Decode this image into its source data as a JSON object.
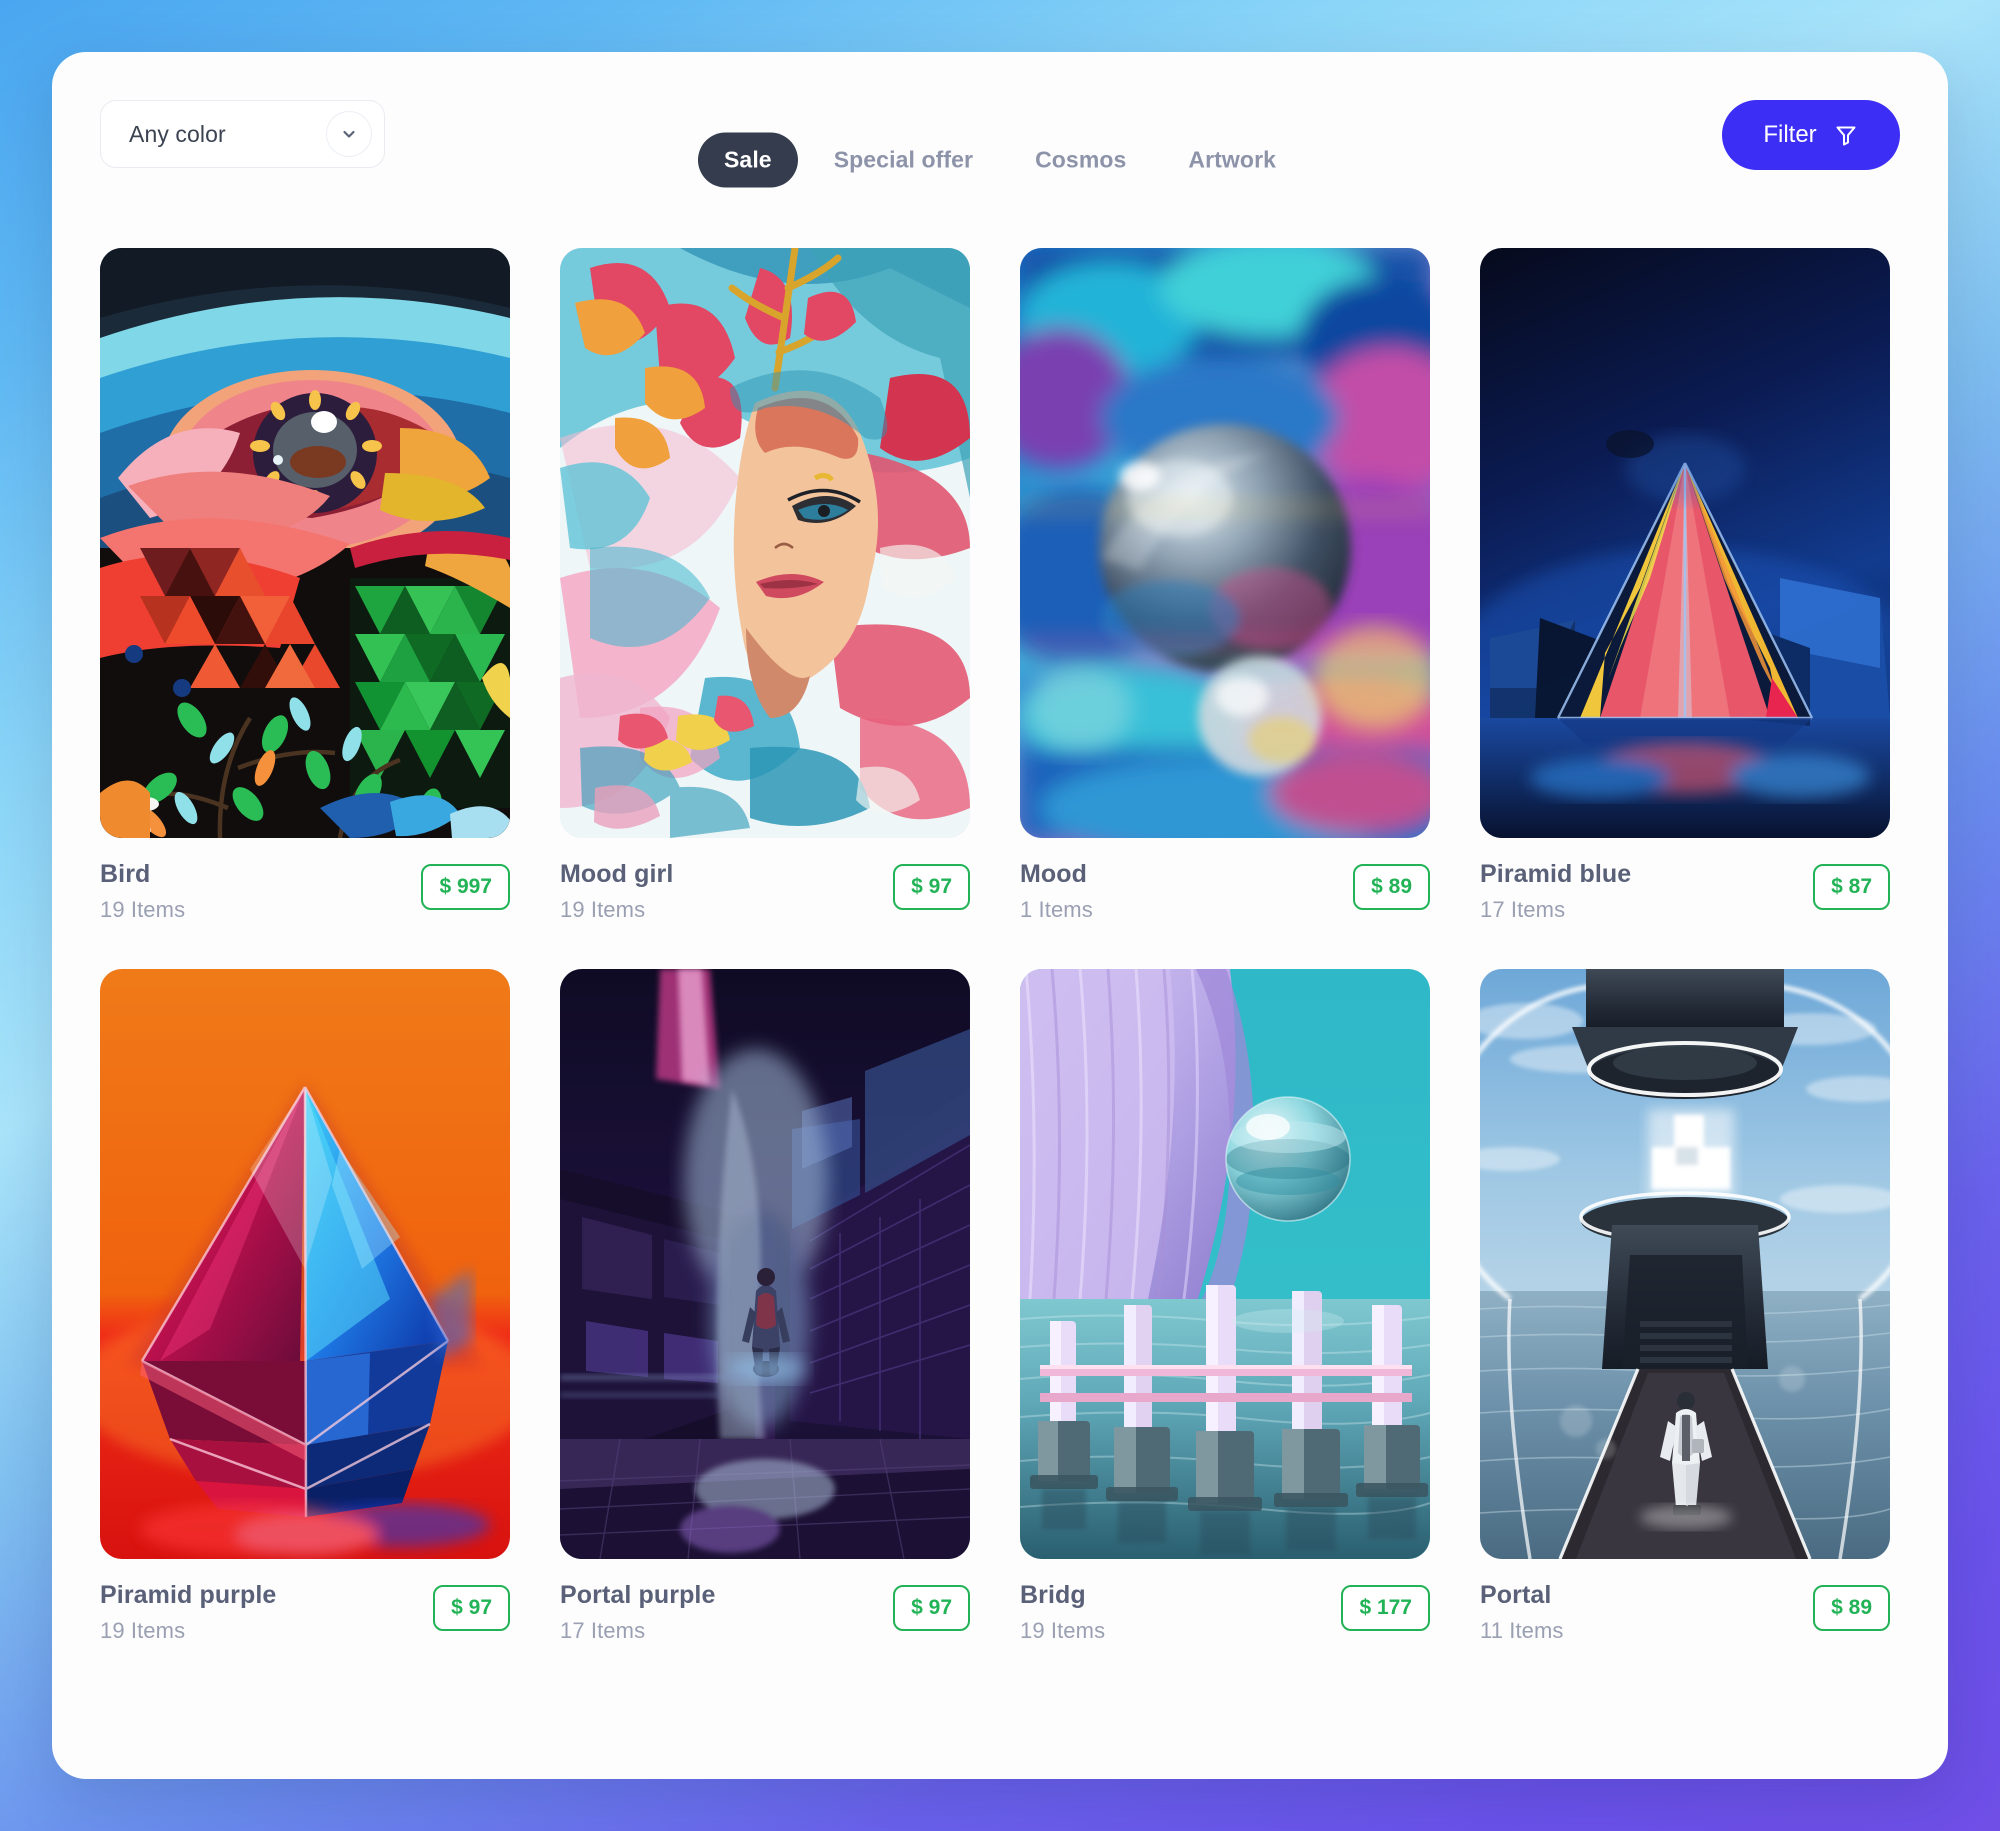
{
  "toolbar": {
    "color_filter": {
      "value": "Any color",
      "chevron_icon": "chevron-down-icon"
    },
    "tabs": [
      {
        "label": "Sale",
        "active": true
      },
      {
        "label": "Special offer",
        "active": false
      },
      {
        "label": "Cosmos",
        "active": false
      },
      {
        "label": "Artwork",
        "active": false
      }
    ],
    "filter_button": {
      "label": "Filter",
      "icon": "funnel-icon",
      "color": "#3c2ef5"
    }
  },
  "colors": {
    "accent": "#3c2ef5",
    "price_green": "#22b356",
    "tab_active_bg": "#353c4e",
    "title_text": "#596077",
    "muted_text": "#9aa0b2",
    "panel_bg": "#fdfdfe"
  },
  "cards": [
    {
      "title": "Bird",
      "items": "19 Items",
      "price": "$ 997",
      "art": "bird"
    },
    {
      "title": "Mood girl",
      "items": "19 Items",
      "price": "$ 97",
      "art": "moodgirl"
    },
    {
      "title": "Mood",
      "items": "1 Items",
      "price": "$ 89",
      "art": "mood"
    },
    {
      "title": "Piramid blue",
      "items": "17 Items",
      "price": "$ 87",
      "art": "piramidblue"
    },
    {
      "title": "Piramid purple",
      "items": "19 Items",
      "price": "$ 97",
      "art": "piramidpurple"
    },
    {
      "title": "Portal purple",
      "items": "17 Items",
      "price": "$ 97",
      "art": "portalpurple"
    },
    {
      "title": "Bridg",
      "items": "19 Items",
      "price": "$ 177",
      "art": "bridg"
    },
    {
      "title": "Portal",
      "items": "11 Items",
      "price": "$ 89",
      "art": "portal"
    }
  ]
}
